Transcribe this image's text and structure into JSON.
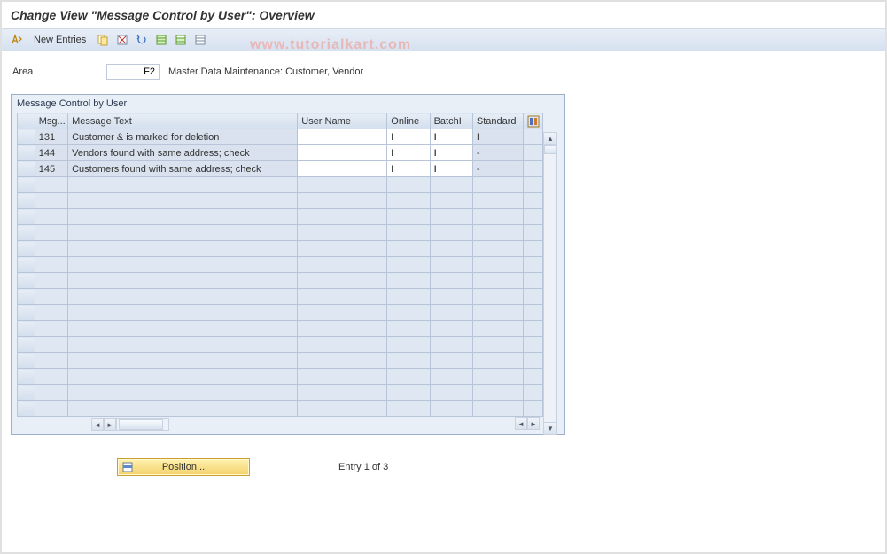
{
  "title": "Change View \"Message Control by User\": Overview",
  "watermark": "www.tutorialkart.com",
  "toolbar": {
    "new_entries_label": "New Entries"
  },
  "area": {
    "label": "Area",
    "value": "F2",
    "description": "Master Data Maintenance: Customer, Vendor"
  },
  "panel": {
    "title": "Message Control by User",
    "columns": {
      "msg": "Msg...",
      "text": "Message Text",
      "user": "User Name",
      "online": "Online",
      "batch": "BatchI",
      "standard": "Standard"
    },
    "rows": [
      {
        "msg": "131",
        "text": "Customer & is marked for deletion",
        "user": "",
        "online": "I",
        "batch": "I",
        "standard": "I"
      },
      {
        "msg": "144",
        "text": "Vendors found with same address; check",
        "user": "",
        "online": "I",
        "batch": "I",
        "standard": "-"
      },
      {
        "msg": "145",
        "text": "Customers found with same address; check",
        "user": "",
        "online": "I",
        "batch": "I",
        "standard": "-"
      }
    ],
    "empty_rows": 15
  },
  "footer": {
    "position_label": "Position...",
    "entry_text": "Entry 1 of 3"
  }
}
